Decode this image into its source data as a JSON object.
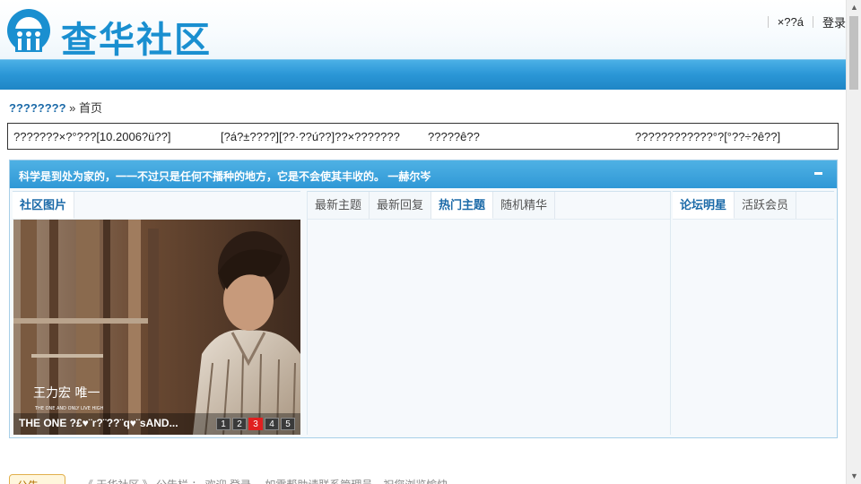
{
  "header": {
    "logo_text": "查华社区",
    "user_links": [
      "×??á",
      "登录"
    ]
  },
  "breadcrumb": {
    "site": "????????",
    "separator": "»",
    "current": "首页"
  },
  "notice": {
    "items": [
      "???????×?°???[10.2006?ü??]",
      "[?á?±????][??·??ú??]??×???????",
      "?????ê??",
      "????????????°?[°??÷?ê??]"
    ]
  },
  "mainbox": {
    "quote": "科学是到处为家的，一一不过只是任何不播种的地方，它是不会使其丰收的。 一赫尔岑",
    "left_tabs": [
      {
        "label": "社区图片",
        "active": true
      }
    ],
    "mid_tabs": [
      {
        "label": "最新主题",
        "active": false
      },
      {
        "label": "最新回复",
        "active": false
      },
      {
        "label": "热门主题",
        "active": true
      },
      {
        "label": "随机精华",
        "active": false
      }
    ],
    "right_tabs": [
      {
        "label": "论坛明星",
        "active": true
      },
      {
        "label": "活跃会员",
        "active": false
      }
    ],
    "photo": {
      "caption": "THE ONE ?£♥¨r?¨??¨q♥¨sAND...",
      "album_text": "王力宏 唯一",
      "album_subtext": "THE ONE AND ONLY  LIVE HIGH",
      "pages": [
        "1",
        "2",
        "3",
        "4",
        "5"
      ],
      "current_page": "3"
    }
  },
  "bottom": {
    "button_label": "公告",
    "text": "《 天华社区 》 公告栏 ： 欢迎 登录 ，如需帮助请联系管理员，祝您浏览愉快。"
  },
  "colors": {
    "accent": "#2a96d6",
    "link": "#1b6aa8",
    "active_page": "#e02020"
  }
}
